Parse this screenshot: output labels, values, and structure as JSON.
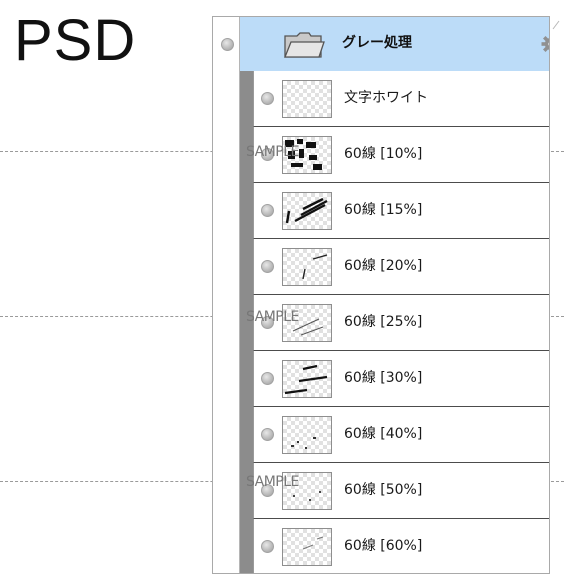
{
  "header": {
    "psd_label": "PSD"
  },
  "watermark": {
    "text": "SAMPLE"
  },
  "layers_panel": {
    "folder": {
      "name": "グレー処理",
      "icon": "folder-icon",
      "settings_icon": "gear-icon"
    },
    "layers": [
      {
        "name": "文字ホワイト",
        "thumb": "blank"
      },
      {
        "name": "60線 [10%]",
        "thumb": "heavy"
      },
      {
        "name": "60線 [15%]",
        "thumb": "strokes"
      },
      {
        "name": "60線 [20%]",
        "thumb": "light"
      },
      {
        "name": "60線 [25%]",
        "thumb": "light"
      },
      {
        "name": "60線 [30%]",
        "thumb": "strokes"
      },
      {
        "name": "60線 [40%]",
        "thumb": "specks"
      },
      {
        "name": "60線 [50%]",
        "thumb": "specks"
      },
      {
        "name": "60線 [60%]",
        "thumb": "specks"
      }
    ]
  },
  "colors": {
    "folder_row_bg": "#bcdcf8",
    "indent_bar": "#8c8c8c",
    "row_border": "#4c4c4c"
  }
}
